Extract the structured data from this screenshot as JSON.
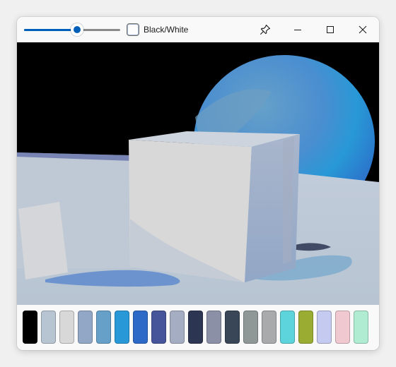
{
  "toolbar": {
    "slider_level": 0.55,
    "bw_label": "Black/White",
    "bw_checked": false,
    "icons": {
      "pin": "pin-icon",
      "minimize": "minimize-icon",
      "maximize": "maximize-icon",
      "close": "close-icon"
    }
  },
  "palette": [
    "#000000",
    "#b7c4d2",
    "#d8d8d8",
    "#92a7c6",
    "#66a0c9",
    "#2898d6",
    "#2d6ac8",
    "#46559a",
    "#a5adc2",
    "#2c3552",
    "#8b90a6",
    "#384657",
    "#8f9797",
    "#a8aaac",
    "#5dd3db",
    "#9aac32",
    "#c4caf0",
    "#f0c8d0",
    "#b0ecd2"
  ]
}
